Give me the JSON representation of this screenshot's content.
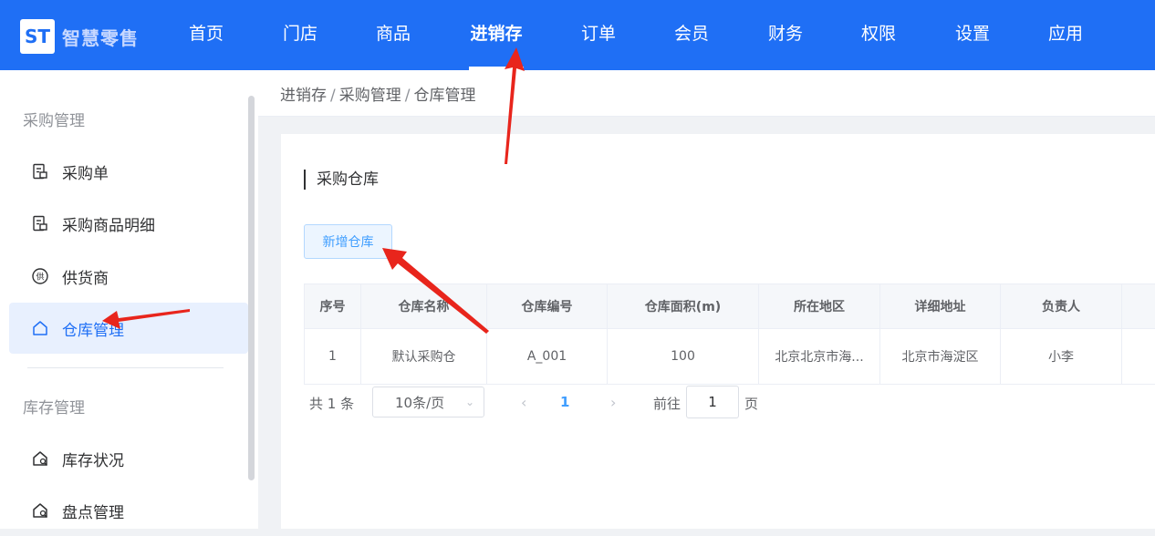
{
  "brand": {
    "logo_letters": "ST",
    "name": "智慧零售"
  },
  "nav": {
    "items": [
      {
        "label": "首页"
      },
      {
        "label": "门店"
      },
      {
        "label": "商品"
      },
      {
        "label": "进销存",
        "active": true
      },
      {
        "label": "订单"
      },
      {
        "label": "会员"
      },
      {
        "label": "财务"
      },
      {
        "label": "权限"
      },
      {
        "label": "设置"
      },
      {
        "label": "应用"
      }
    ]
  },
  "sidebar": {
    "group1": "采购管理",
    "group2": "库存管理",
    "items": [
      {
        "label": "采购单",
        "icon": "document-icon"
      },
      {
        "label": "采购商品明细",
        "icon": "document-icon"
      },
      {
        "label": "供货商",
        "icon": "supplier-icon",
        "icon_char": "供"
      },
      {
        "label": "仓库管理",
        "icon": "house-icon",
        "active": true
      },
      {
        "label": "库存状况",
        "icon": "house-search-icon"
      },
      {
        "label": "盘点管理",
        "icon": "house-search-icon"
      }
    ]
  },
  "breadcrumb": {
    "items": [
      "进销存",
      "采购管理",
      "仓库管理"
    ],
    "separator": "/"
  },
  "main": {
    "section_title": "采购仓库",
    "add_button": "新增仓库",
    "table": {
      "columns": [
        "序号",
        "仓库名称",
        "仓库编号",
        "仓库面积(m)",
        "所在地区",
        "详细地址",
        "负责人"
      ],
      "rows": [
        [
          "1",
          "默认采购仓",
          "A_001",
          "100",
          "北京北京市海...",
          "北京市海淀区",
          "小李"
        ]
      ]
    },
    "pagination": {
      "total": "共 1 条",
      "page_size": "10条/页",
      "current_page": "1",
      "goto_label": "前往",
      "goto_value": "1",
      "page_unit": "页"
    }
  },
  "colors": {
    "primary": "#1f6ff5",
    "annotation": "#e8251c",
    "active_bg": "#e8f0fe"
  }
}
